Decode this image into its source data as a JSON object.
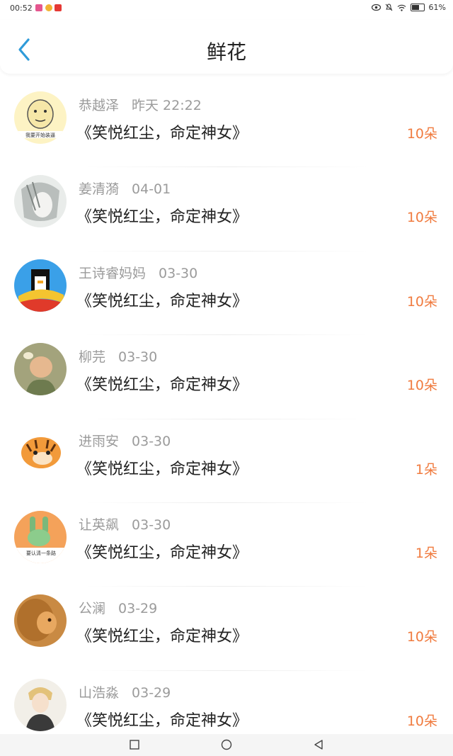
{
  "status_bar": {
    "time": "00:52",
    "battery_level": "61%"
  },
  "header": {
    "title": "鲜花",
    "back_icon": "chevron-left-icon"
  },
  "accent_color": "#f07b3f",
  "link_color": "#2f9bd9",
  "list": [
    {
      "name": "恭越泽",
      "date": "昨天 22:22",
      "work": "《笑悦红尘，命定神女》",
      "count": "10朵"
    },
    {
      "name": "姜清漪",
      "date": "04-01",
      "work": "《笑悦红尘，命定神女》",
      "count": "10朵"
    },
    {
      "name": "王诗睿妈妈",
      "date": "03-30",
      "work": "《笑悦红尘，命定神女》",
      "count": "10朵"
    },
    {
      "name": "柳芫",
      "date": "03-30",
      "work": "《笑悦红尘，命定神女》",
      "count": "10朵"
    },
    {
      "name": "进雨安",
      "date": "03-30",
      "work": "《笑悦红尘，命定神女》",
      "count": "1朵"
    },
    {
      "name": "让英飙",
      "date": "03-30",
      "work": "《笑悦红尘，命定神女》",
      "count": "1朵"
    },
    {
      "name": "公澜",
      "date": "03-29",
      "work": "《笑悦红尘，命定神女》",
      "count": "10朵"
    },
    {
      "name": "山浩淼",
      "date": "03-29",
      "work": "《笑悦红尘，命定神女》",
      "count": "10朵"
    }
  ]
}
